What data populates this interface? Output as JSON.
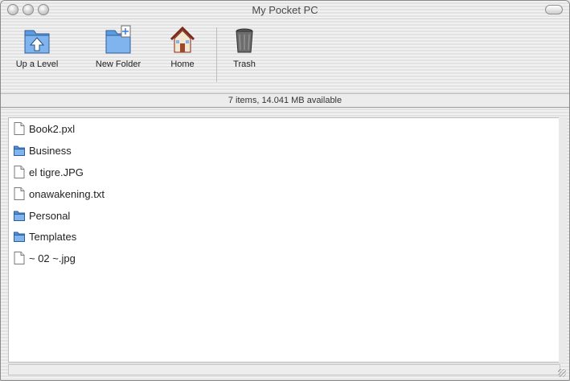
{
  "window": {
    "title": "My Pocket PC"
  },
  "toolbar": {
    "buttons": [
      {
        "label": "Up a Level",
        "icon": "up-level-folder-icon"
      },
      {
        "label": "New Folder",
        "icon": "new-folder-icon"
      },
      {
        "label": "Home",
        "icon": "home-icon"
      },
      {
        "label": "Trash",
        "icon": "trash-icon"
      }
    ]
  },
  "status": {
    "text": "7 items, 14.041 MB available"
  },
  "files": [
    {
      "name": "Book2.pxl",
      "kind": "document-icon"
    },
    {
      "name": "Business",
      "kind": "folder-icon"
    },
    {
      "name": "el tigre.JPG",
      "kind": "document-icon"
    },
    {
      "name": "onawakening.txt",
      "kind": "document-icon"
    },
    {
      "name": "Personal",
      "kind": "folder-icon"
    },
    {
      "name": "Templates",
      "kind": "folder-icon"
    },
    {
      "name": "~ 02 ~.jpg",
      "kind": "document-icon"
    }
  ],
  "colors": {
    "folder": "#4f8fd8",
    "window_bg": "#e6e6e6"
  }
}
